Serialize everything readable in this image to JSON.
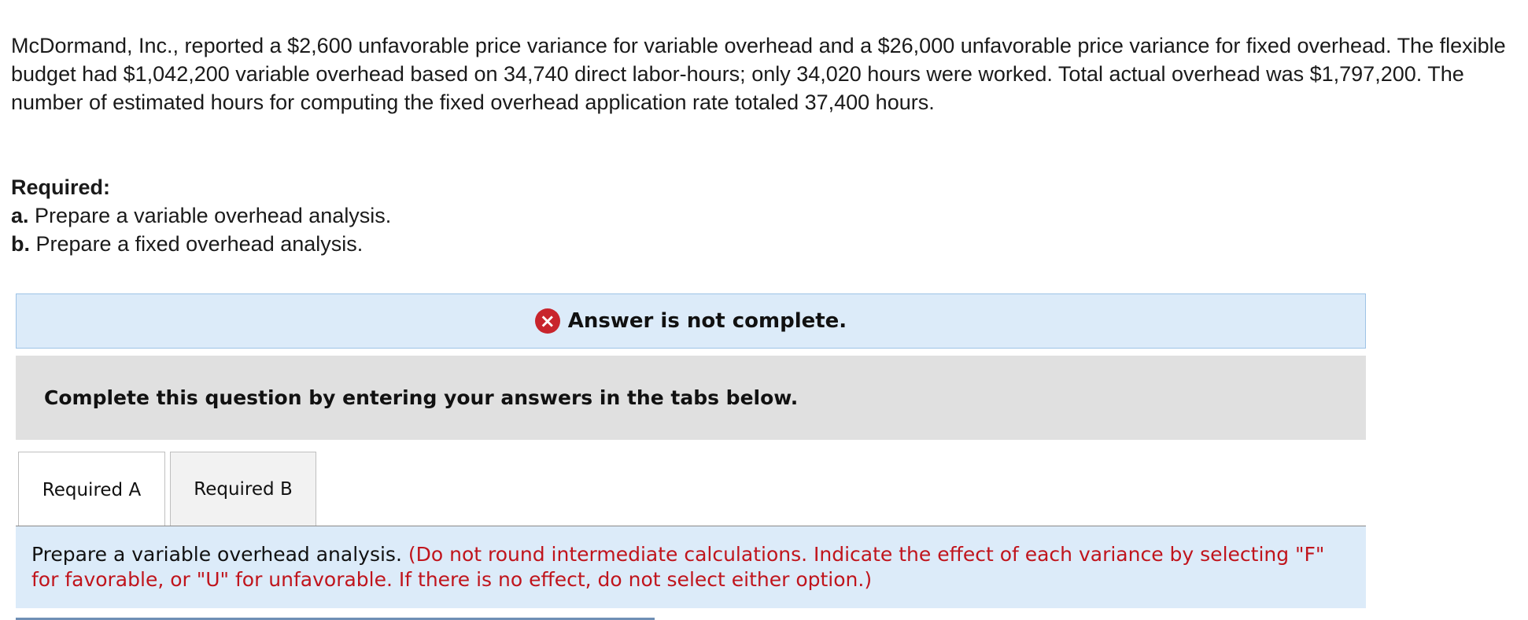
{
  "problem": {
    "text": "McDormand, Inc., reported a $2,600 unfavorable price variance for variable overhead and a $26,000 unfavorable price variance for fixed overhead. The flexible budget had $1,042,200 variable overhead based on 34,740 direct labor-hours; only 34,020 hours were worked. Total actual overhead was $1,797,200. The number of estimated hours for computing the fixed overhead application rate totaled 37,400 hours."
  },
  "required": {
    "label": "Required:",
    "items": [
      {
        "letter": "a.",
        "text": "Prepare a variable overhead analysis."
      },
      {
        "letter": "b.",
        "text": "Prepare a fixed overhead analysis."
      }
    ]
  },
  "status": {
    "icon": "x-circle-icon",
    "text": "Answer is not complete.",
    "color": "#c8242c"
  },
  "instruction": {
    "text": "Complete this question by entering your answers in the tabs below."
  },
  "tabs": [
    {
      "label": "Required A",
      "active": true
    },
    {
      "label": "Required B",
      "active": false
    }
  ],
  "prompt": {
    "main": "Prepare a variable overhead analysis.",
    "note": "(Do not round intermediate calculations. Indicate the effect of each variance by selecting \"F\" for favorable, or \"U\" for unfavorable. If there is no effect, do not select either option.)",
    "note_color": "#c0141c"
  }
}
